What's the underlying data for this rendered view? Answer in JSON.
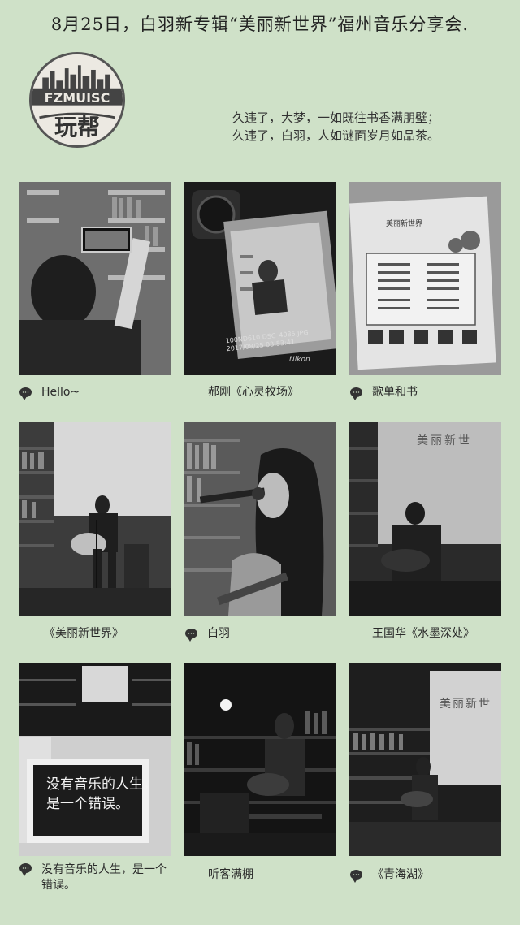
{
  "header": {
    "title": "8月25日，白羽新专辑“美丽新世界”福州音乐分享会."
  },
  "logo": {
    "brand_text": "FZMUISC",
    "brand_cn": "玩帮"
  },
  "intro": {
    "line1": "久违了，大梦，一如既往书香满朋壁；",
    "line2": "久违了，白羽，人如谜面岁月如品茶。"
  },
  "photos": [
    {
      "caption": "Hello~",
      "icon": "chat-icon"
    },
    {
      "caption": "郝刚《心灵牧场》",
      "icon": ""
    },
    {
      "caption": "歌单和书",
      "icon": "chat-icon"
    },
    {
      "caption": "《美丽新世界》",
      "icon": ""
    },
    {
      "caption": "白羽",
      "icon": "chat-icon"
    },
    {
      "caption": "王国华《水墨深处》",
      "icon": ""
    },
    {
      "caption": "没有音乐的人生，是一个错误。",
      "icon": "chat-icon"
    },
    {
      "caption": "听客满棚",
      "icon": ""
    },
    {
      "caption": "《青海湖》",
      "icon": "chat-icon"
    }
  ],
  "photo_text": {
    "camera_readout": "100ND610 DSC_4085.JPG",
    "camera_date": "2017/08/25 03:53:41",
    "camera_brand": "Nikon",
    "setlist_header": "美丽新世界",
    "sign_line1": "没有音乐的人生，",
    "sign_line2": "是一个错误。",
    "banner_text": "美丽新世"
  },
  "colors": {
    "background": "#cfe1c8",
    "text": "#222222"
  }
}
